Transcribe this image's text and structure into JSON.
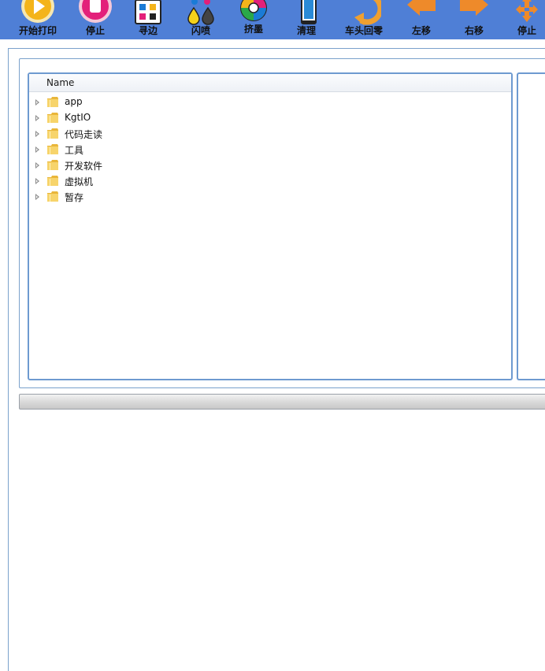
{
  "toolbar": {
    "buttons": [
      {
        "label": "开始打印",
        "icon": "play-icon"
      },
      {
        "label": "停止",
        "icon": "stop-icon"
      },
      {
        "label": "寻边",
        "icon": "grid-icon"
      },
      {
        "label": "闪喷",
        "icon": "ink-drops-icon"
      },
      {
        "label": "挤墨",
        "icon": "color-wheel-icon"
      },
      {
        "label": "清理",
        "icon": "clean-icon"
      },
      {
        "label": "车头回零",
        "icon": "rotate-icon"
      },
      {
        "label": "左移",
        "icon": "arrow-left-icon"
      },
      {
        "label": "右移",
        "icon": "arrow-right-icon"
      },
      {
        "label": "停止",
        "icon": "move-cross-icon"
      }
    ]
  },
  "tree": {
    "column_header": "Name",
    "items": [
      {
        "name": "app"
      },
      {
        "name": "KgtIO"
      },
      {
        "name": "代码走读"
      },
      {
        "name": "工具"
      },
      {
        "name": "开发软件"
      },
      {
        "name": "虚拟机"
      },
      {
        "name": "暂存"
      }
    ]
  },
  "colors": {
    "toolbar_bg": "#4f7fd6",
    "panel_border": "#6e9ad0",
    "folder_yellow": "#f0c44a"
  }
}
